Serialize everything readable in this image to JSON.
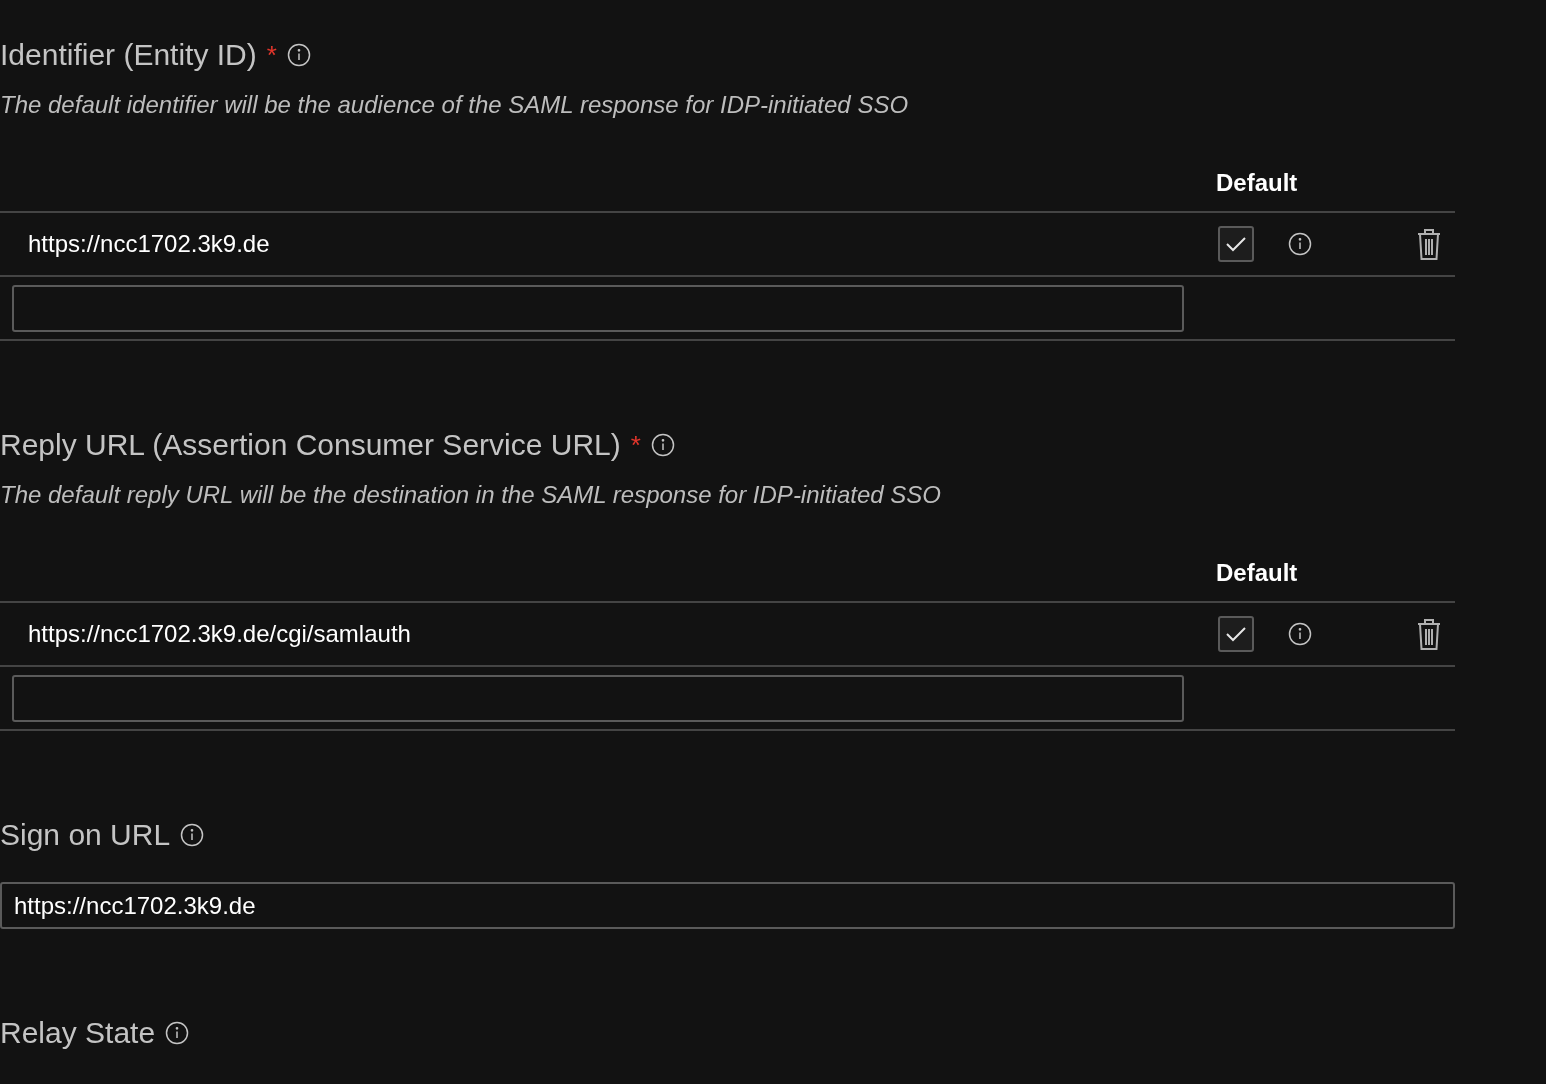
{
  "sections": [
    {
      "kind": "multi",
      "label": "Identifier (Entity ID)",
      "required_mark": "*",
      "description": "The default identifier will be the audience of the SAML response for IDP-initiated SSO",
      "default_header": "Default",
      "entries": [
        {
          "value": "https://ncc1702.3k9.de",
          "default": true
        }
      ]
    },
    {
      "kind": "multi",
      "label": "Reply URL (Assertion Consumer Service URL)",
      "required_mark": "*",
      "description": "The default reply URL will be the destination in the SAML response for IDP-initiated SSO",
      "default_header": "Default",
      "entries": [
        {
          "value": "https://ncc1702.3k9.de/cgi/samlauth",
          "default": true
        }
      ]
    },
    {
      "kind": "single",
      "label": "Sign on URL",
      "value": "https://ncc1702.3k9.de"
    },
    {
      "kind": "label",
      "label": "Relay State"
    }
  ]
}
